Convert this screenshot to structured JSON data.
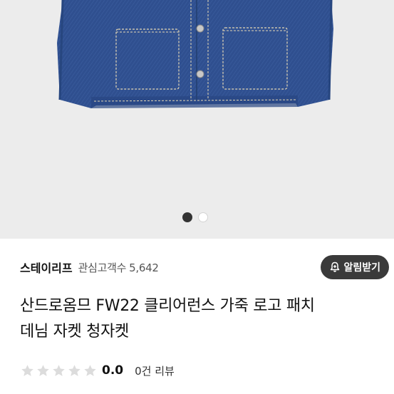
{
  "product": {
    "image_label": "denim-jacket-photo",
    "carousel": {
      "total": 2,
      "active_index": 0
    },
    "seller": {
      "name": "스테이리프",
      "interest_label": "관심고객수",
      "interest_count": "5,642",
      "alert_button": "알림받기"
    },
    "title_line1": "산드로옴므 FW22 클리어런스 가죽 로고 패치",
    "title_line2": "데님 자켓 청자켓",
    "rating": {
      "value": "0.0",
      "stars_filled": 0,
      "stars_total": 5
    },
    "reviews": "0건 리뷰"
  },
  "colors": {
    "denim": "#2f4f8f",
    "background": "#ececec",
    "button": "#3a3a3a"
  }
}
